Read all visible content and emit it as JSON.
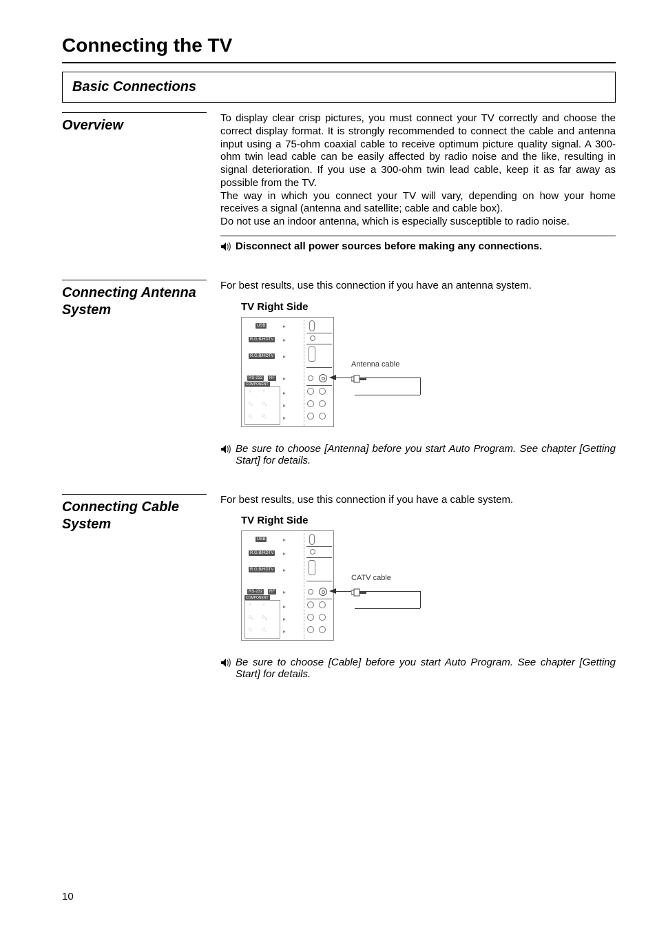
{
  "page": {
    "title": "Connecting the TV",
    "number": "10"
  },
  "basic_connections_label": "Basic Connections",
  "overview": {
    "heading": "Overview",
    "body": "To display clear crisp pictures, you must connect your TV correctly and choose the correct display format. It is strongly recommended to connect the cable and antenna input using a 75-ohm coaxial cable to receive optimum picture quality signal. A 300-ohm twin lead cable can be easily affected by radio noise and the like, resulting in signal deterioration. If you use a 300-ohm twin lead cable, keep it as far away as possible from the TV.\nThe way in which you connect your TV will vary, depending on how your home receives a signal (antenna and satellite; cable and cable box).\nDo not use an indoor antenna, which is especially susceptible to radio noise.",
    "note": "Disconnect all power sources before making any connections."
  },
  "antenna": {
    "heading": "Connecting Antenna System",
    "intro": "For best results, use this connection if you have an antenna system.",
    "diagram_title": "TV Right Side",
    "cable_label": "Antenna cable",
    "note": "Be sure to choose [Antenna] before you start Auto Program. See chapter [Getting Start] for details."
  },
  "cable": {
    "heading": "Connecting Cable System",
    "intro": "For best results, use this connection if you have a cable system.",
    "diagram_title": "TV Right Side",
    "cable_label": "CATV cable",
    "note": "Be sure to choose [Cable] before you start Auto Program. See chapter [Getting Start] for details."
  },
  "panel_labels": {
    "usb": "USB",
    "rgb1": "R.G.B/HDTV",
    "rgb2": "R.G.B/HDTV",
    "rs232": "RS-232",
    "rf": "RF",
    "component": "COMPONENT"
  }
}
